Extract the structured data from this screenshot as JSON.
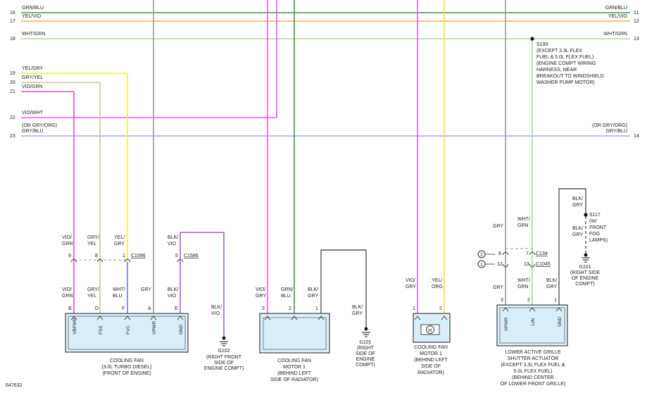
{
  "figure_id": "647632",
  "colors": {
    "grn_blu": "#3a9a4a",
    "yel_vio": "#f2b24a",
    "wht_grn": "#a8d898",
    "yel_gry": "#f0ee3c",
    "gry_yel": "#c8c89a",
    "vio_grn": "#d94ecf",
    "vio_wht": "#ef55e8",
    "gry_blu": "#a8a8e8",
    "vio": "#e060e0",
    "gry": "#9a9a9a",
    "blk": "#555555",
    "blu": "#6a7adf",
    "org_yel": "#f7e12a",
    "component_fill": "#d9eef9",
    "component_stroke": "#444444"
  },
  "left_rows": [
    {
      "num": "16",
      "label": "GRN/BLU"
    },
    {
      "num": "17",
      "label": "YEL/VIO"
    },
    {
      "num": "18",
      "label": "WHT/GRN"
    },
    {
      "num": "19",
      "label": "YEL/GRY"
    },
    {
      "num": "20",
      "label": "GRY/YEL"
    },
    {
      "num": "21",
      "label": "VIO/GRN"
    },
    {
      "num": "22",
      "label": "VIO/WHT"
    },
    {
      "num": "23",
      "label": "GRY/BLU",
      "alt": "(OR GRY/ORG)"
    }
  ],
  "right_rows": [
    {
      "num": "11",
      "label": "GRN/BLU"
    },
    {
      "num": "12",
      "label": "YEL/VIO"
    },
    {
      "num": "13",
      "label": "WHT/GRN"
    },
    {
      "num": "14",
      "label": "GRY/BLU",
      "alt": "(OR GRY/ORG)"
    }
  ],
  "splice_s199": {
    "id": "S199",
    "lines": [
      "(EXCEPT 3.3L FLEX",
      "FUEL & 5.0L FLEX FUEL)",
      "(ENGINE COMPT WIRING",
      "HARNESS, NEAR",
      "BREAKOUT TO WINDSHIELD",
      "WASHER PUMP MOTOR)"
    ]
  },
  "splice_s117": {
    "wire": [
      "BLK/",
      "GRY"
    ],
    "lines": [
      "S117",
      "(W/",
      "FRONT",
      "FOG",
      "LAMPS)"
    ]
  },
  "connectors": {
    "c1586_a": "C1586",
    "c1586_b": "C1586",
    "c134": "C134",
    "c1045": "C1045"
  },
  "conn_wires": {
    "w1": [
      "VIO/",
      "GRN"
    ],
    "w2": [
      "GRY/",
      "YEL"
    ],
    "w3": [
      "YEL/",
      "GRY"
    ],
    "w4": [
      "BLK/",
      "VIO"
    ],
    "w5": [
      "GRY"
    ],
    "w6": [
      "WHT/",
      "GRN"
    ],
    "w7": [
      "BLK/",
      "GRY"
    ]
  },
  "conn_pins": {
    "p9": "9",
    "p8": "8",
    "p1": "1",
    "p5": "5",
    "p8b": "8",
    "p7": "7",
    "p12": "12",
    "p13": "13",
    "circ2": "2",
    "circ1": "1"
  },
  "cooling_fan_turbo": {
    "wires": [
      [
        "VIO/",
        "GRN"
      ],
      [
        "GRY/",
        "YEL"
      ],
      [
        "WHT/",
        "BLU"
      ],
      [
        "GRY"
      ],
      [
        "BLK/",
        "VIO"
      ]
    ],
    "pins": [
      "B",
      "D",
      "F",
      "A",
      "E"
    ],
    "functions": [
      "VBPWR",
      "FSS",
      "FVC",
      "VPWR",
      "GND"
    ],
    "title": [
      "COOLING FAN",
      "(3.0L TURBO DIESEL)",
      "(FRONT OF ENGINE)"
    ]
  },
  "cooling_fan_motor1_left": {
    "wires": [
      [
        "VIO/",
        "GRY"
      ],
      [
        "GRN/",
        "BLU"
      ],
      [
        "BLK/",
        "GRY"
      ]
    ],
    "pins": [
      "3",
      "2",
      "1"
    ],
    "title": [
      "COOLING FAN",
      "MOTOR 1",
      "(BEHIND LEFT",
      "SIDE OF RADIATOR)"
    ]
  },
  "cooling_fan_motor1_radiator": {
    "wires": [
      [
        "VIO/",
        "GRY"
      ],
      [
        "YEL/",
        "ORG"
      ]
    ],
    "pins": [
      "1",
      "2"
    ],
    "motor_symbol": "M",
    "title": [
      "COOLING FAN",
      "MOTOR 1",
      "(BEHIND LEFT",
      "SIDE OF",
      "RADIATOR)"
    ]
  },
  "grille_actuator": {
    "wires": [
      [
        "GRY"
      ],
      [
        "WHT/",
        "GRN"
      ],
      [
        "BLK/",
        "GRY"
      ]
    ],
    "pins": [
      "3",
      "2",
      "1"
    ],
    "functions": [
      "VPWR",
      "LIN",
      "GND"
    ],
    "title": [
      "LOWER ACTIVE GRILLE",
      "SHUTTER ACTUATOR",
      "(EXCEPT 3.3L FLEX FUEL &",
      "5.0L FLEX FUEL)",
      "(BEHIND CENTER",
      "OF LOWER FRONT GRILLE)"
    ]
  },
  "grounds": {
    "g102": {
      "wire": [
        "BLK/",
        "VIO"
      ],
      "lines": [
        "G102",
        "(RIGHT FRONT",
        "SIDE OF",
        "ENGINE COMPT)"
      ]
    },
    "g101_a": {
      "wire": [
        "BLK/",
        "GRY"
      ],
      "lines": [
        "G101",
        "(RIGHT",
        "SIDE OF",
        "ENGINE",
        "COMPT)"
      ]
    },
    "g101_b": {
      "lines": [
        "G101",
        "(RIGHT SIDE",
        "OF ENGINE",
        "COMPT)"
      ]
    }
  }
}
